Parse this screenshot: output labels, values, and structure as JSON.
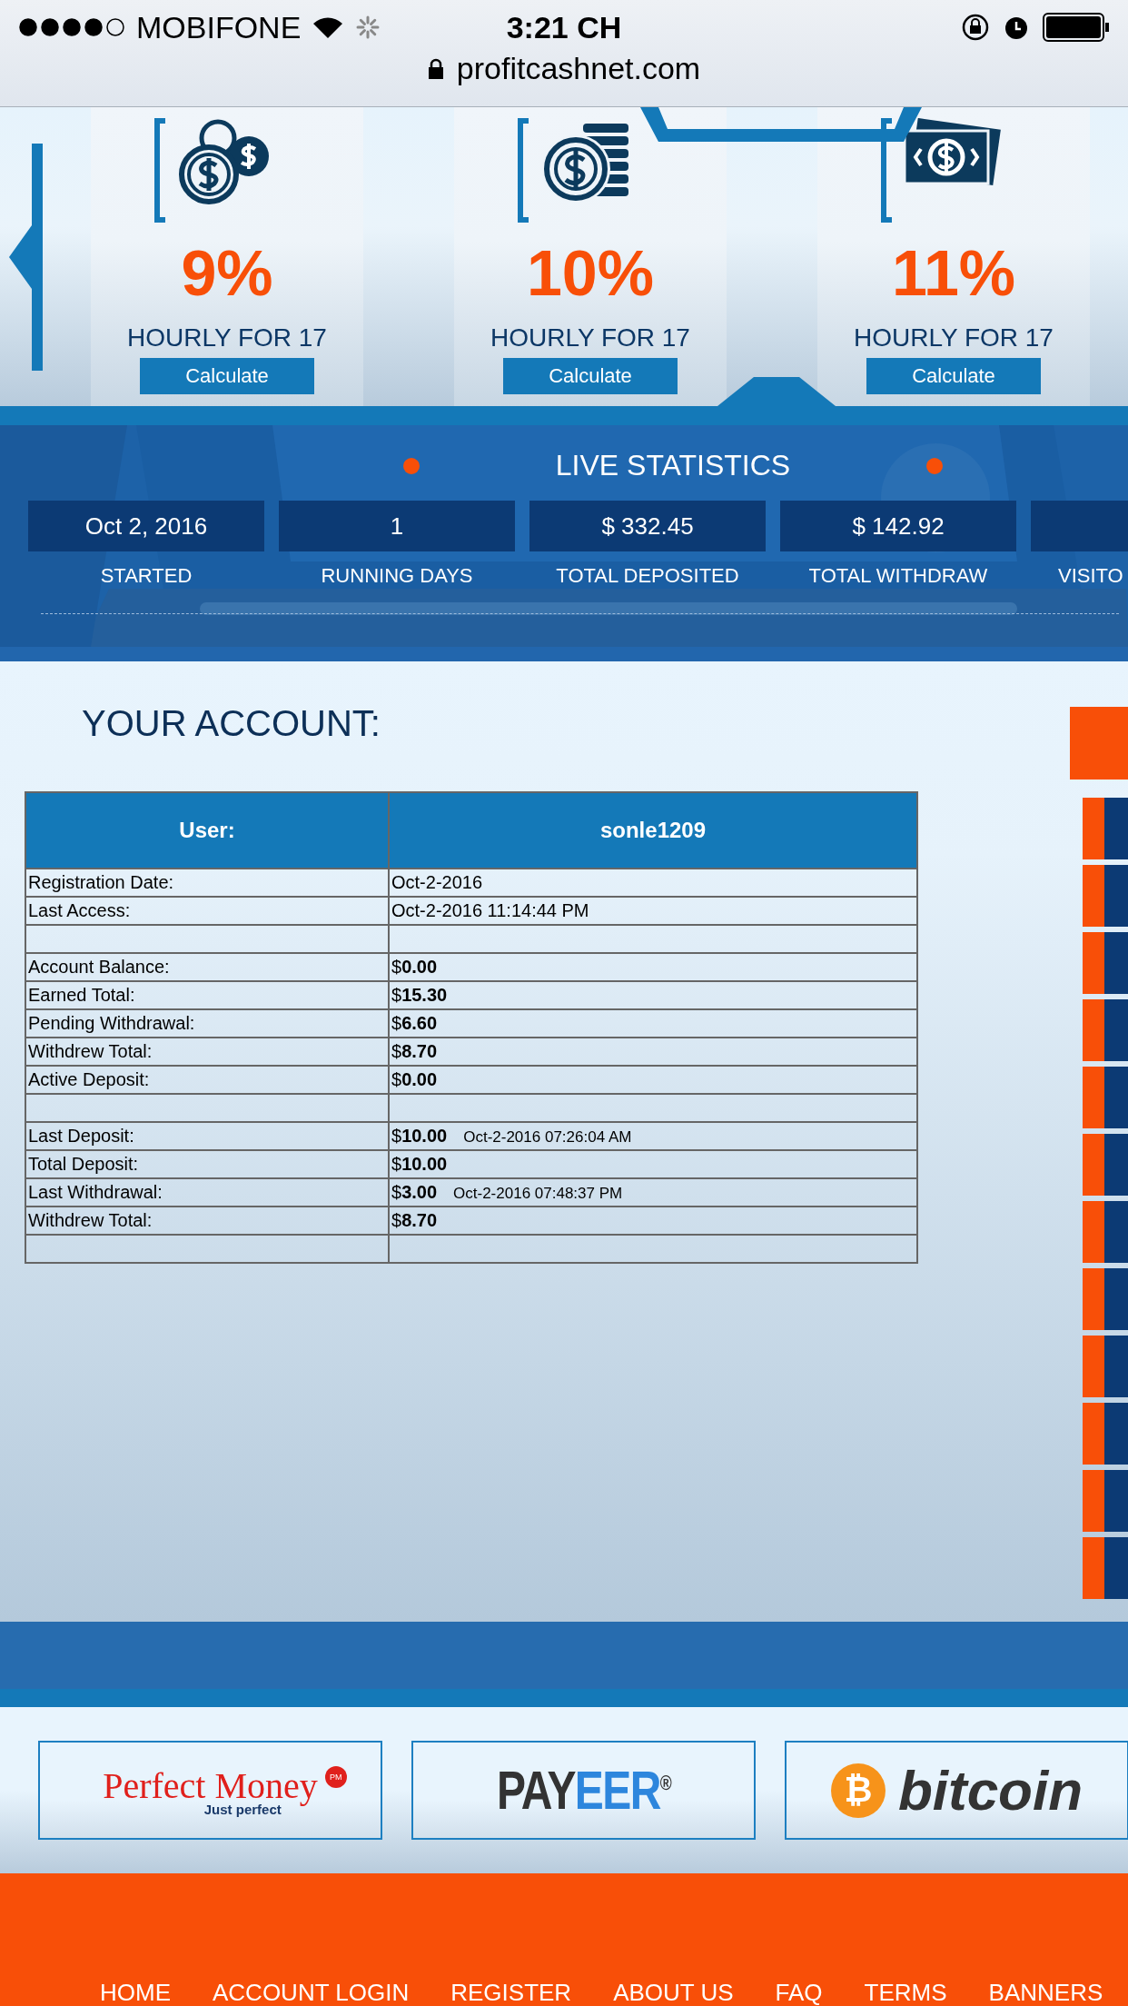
{
  "status_bar": {
    "carrier": "MOBIFONE",
    "time": "3:21 CH",
    "url": "profitcashnet.com"
  },
  "plans": [
    {
      "kind": "coins",
      "rate": "9%",
      "term": "HOURLY FOR 17",
      "button": "Calculate"
    },
    {
      "kind": "stack",
      "rate": "10%",
      "term": "HOURLY FOR 17",
      "button": "Calculate"
    },
    {
      "kind": "banknote",
      "rate": "11%",
      "term": "HOURLY FOR 17",
      "button": "Calculate"
    }
  ],
  "live_statistics": {
    "title": "LIVE STATISTICS",
    "stats": [
      {
        "value": "Oct 2, 2016",
        "label": "STARTED"
      },
      {
        "value": "1",
        "label": "RUNNING DAYS"
      },
      {
        "value": "$ 332.45",
        "label": "TOTAL DEPOSITED"
      },
      {
        "value": "$ 142.92",
        "label": "TOTAL WITHDRAW"
      },
      {
        "label": "VISITO"
      }
    ]
  },
  "account": {
    "title": "YOUR ACCOUNT:",
    "header": [
      "User:",
      "sonle1209"
    ],
    "rows": [
      {
        "kind": "data",
        "label": "Registration Date:",
        "value": "Oct-2-2016"
      },
      {
        "kind": "data",
        "label": "Last Access:",
        "value": "Oct-2-2016 11:14:44 PM"
      },
      {
        "kind": "spacer"
      },
      {
        "kind": "data",
        "label": "Account Balance:",
        "value": "$**0.00**"
      },
      {
        "kind": "data",
        "label": "Earned Total:",
        "value": "$**15.30**"
      },
      {
        "kind": "data",
        "label": "Pending Withdrawal:",
        "value": "$**6.60**"
      },
      {
        "kind": "data",
        "label": "Withdrew Total:",
        "value": "$**8.70**"
      },
      {
        "kind": "data",
        "label": "Active Deposit:",
        "value": "$**0.00**"
      },
      {
        "kind": "spacer"
      },
      {
        "kind": "data",
        "label": "Last Deposit:",
        "value": "$**10.00**",
        "note": "Oct-2-2016 07:26:04 AM"
      },
      {
        "kind": "data",
        "label": "Total Deposit:",
        "value": "$**10.00**"
      },
      {
        "kind": "data",
        "label": "Last Withdrawal:",
        "value": "$**3.00**",
        "note": "Oct-2-2016 07:48:37 PM"
      },
      {
        "kind": "data",
        "label": "Withdrew Total:",
        "value": "$**8.70**"
      },
      {
        "kind": "spacer"
      }
    ]
  },
  "payment_logos": [
    {
      "kind": "perfectmoney",
      "name": "Perfect Money",
      "tagline": "Just perfect",
      "badge": "PM"
    },
    {
      "kind": "payeer",
      "parts": [
        "PAY",
        "EER"
      ],
      "mark": "®"
    },
    {
      "kind": "bitcoin",
      "name": "bitcoin",
      "symbol": "₿"
    }
  ],
  "footer_nav": [
    "HOME",
    "ACCOUNT LOGIN",
    "REGISTER",
    "ABOUT US",
    "FAQ",
    "TERMS",
    "BANNERS"
  ]
}
